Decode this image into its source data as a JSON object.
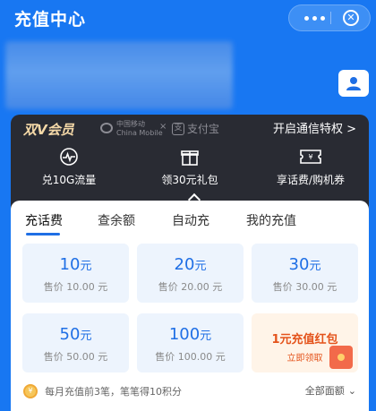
{
  "header": {
    "title": "充值中心",
    "more_icon": "more-dots-icon",
    "close_icon": "close-circle-icon"
  },
  "account": {
    "user_icon": "user-icon"
  },
  "vip": {
    "logo": "双V会员",
    "partner_cm": "中国移动",
    "partner_cm_en": "China Mobile",
    "separator": "×",
    "partner_ali": "支付宝",
    "open_label": "开启通信特权 >",
    "features": [
      {
        "icon": "signal-wave-icon",
        "label": "兑10G流量"
      },
      {
        "icon": "gift-icon",
        "label": "领30元礼包"
      },
      {
        "icon": "ticket-icon",
        "label": "享话费/购机券"
      }
    ],
    "caret_icon": "chevron-up-icon"
  },
  "tabs": [
    {
      "label": "充话费",
      "active": true
    },
    {
      "label": "查余额",
      "active": false
    },
    {
      "label": "自动充",
      "active": false
    },
    {
      "label": "我的充值",
      "active": false
    }
  ],
  "recharge": {
    "unit": "元",
    "options": [
      {
        "amount": "10",
        "price": "售价 10.00 元"
      },
      {
        "amount": "20",
        "price": "售价 20.00 元"
      },
      {
        "amount": "30",
        "price": "售价 30.00 元"
      },
      {
        "amount": "50",
        "price": "售价 50.00 元"
      },
      {
        "amount": "100",
        "price": "售价 100.00 元"
      }
    ],
    "promo": {
      "title": "1元充值红包",
      "subtitle": "立即领取",
      "icon": "red-envelope-icon"
    }
  },
  "footer": {
    "notice": "每月充值前3笔，笔笔得10积分",
    "coin_icon": "points-coin-icon",
    "all_amounts": "全部面额",
    "chevron_icon": "chevron-down-icon"
  },
  "colors": {
    "brand_blue": "#1877f2",
    "accent_blue": "#1f6fe5",
    "vip_dark": "#292b33",
    "promo_orange": "#e4531b"
  }
}
